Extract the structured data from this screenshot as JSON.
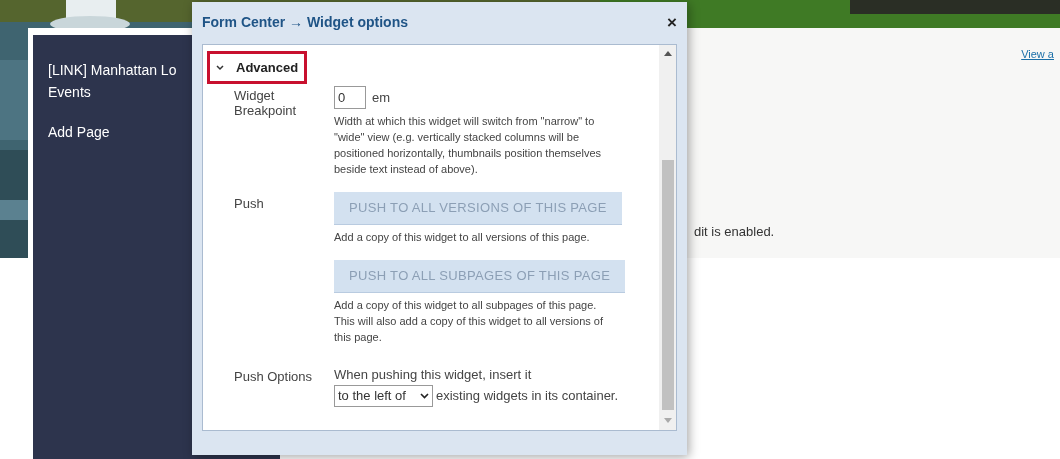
{
  "sidebar": {
    "items": [
      "[LINK] Manhattan Lo",
      "Events",
      "Add Page"
    ]
  },
  "page": {
    "link": "View a",
    "notice": "dit is enabled."
  },
  "modal": {
    "title": "Form Center → Widget options",
    "close": "×",
    "section": {
      "label": "Advanced",
      "expanded": true
    },
    "breakpoint": {
      "label": "Widget Breakpoint",
      "value": "0",
      "unit": "em",
      "help": "Width at which this widget will switch from \"narrow\" to \"wide\" view (e.g. vertically stacked columns will be positioned horizontally, thumbnails position themselves beside text instead of above)."
    },
    "push": {
      "label": "Push",
      "actions": [
        {
          "label": "PUSH TO ALL VERSIONS OF THIS PAGE",
          "disabled": true,
          "help": "Add a copy of this widget to all versions of this page."
        },
        {
          "label": "PUSH TO ALL SUBPAGES OF THIS PAGE",
          "disabled": true,
          "help": "Add a copy of this widget to all subpages of this page. This will also add a copy of this widget to all versions of this page."
        }
      ]
    },
    "push_options": {
      "label": "Push Options",
      "prefix": "When pushing this widget, insert it",
      "select": "to the left of",
      "suffix": "existing widgets in its container."
    }
  }
}
